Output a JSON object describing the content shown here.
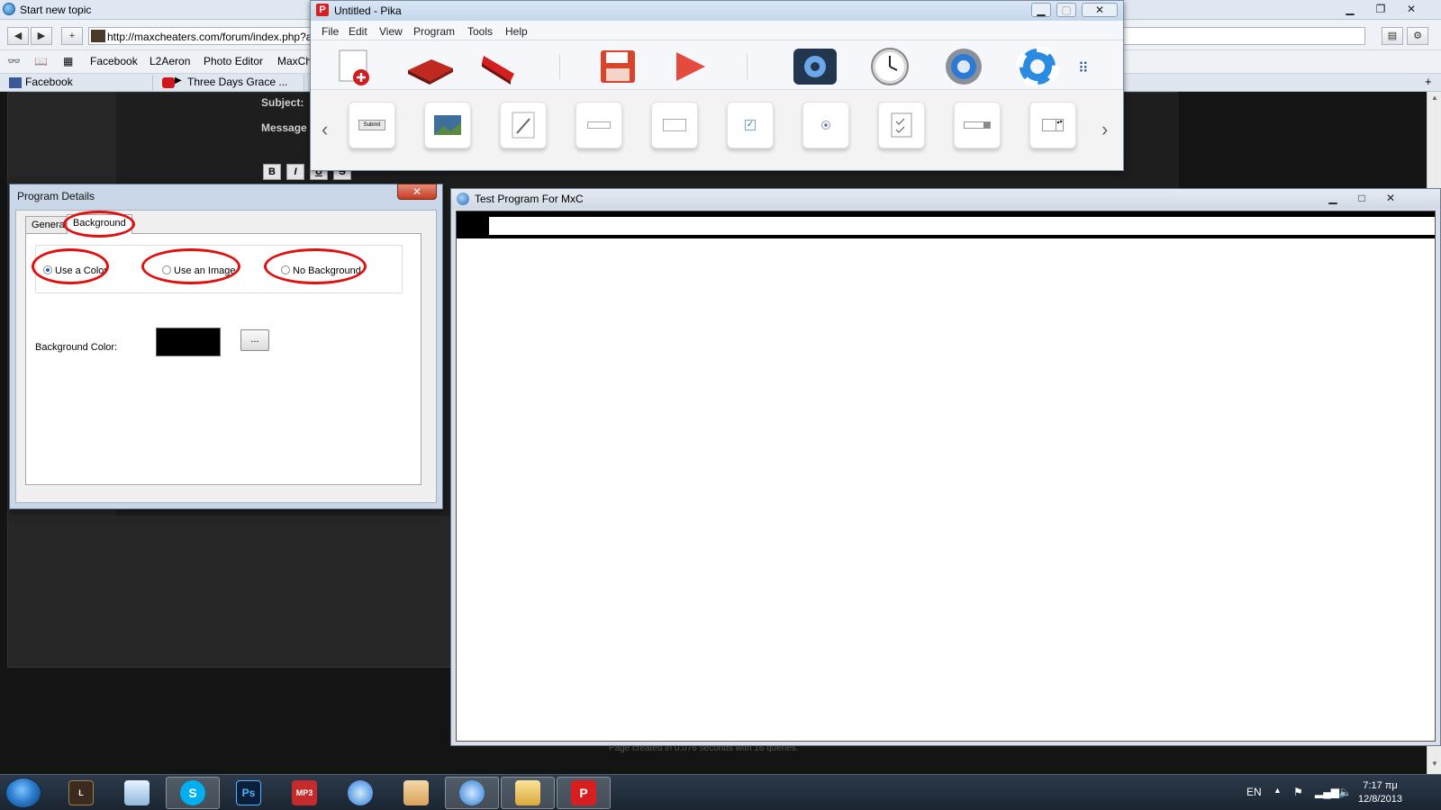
{
  "browser": {
    "tab_title": "Start new topic",
    "url": "http://maxcheaters.com/forum/index.php?a",
    "bookmarks": [
      "Facebook",
      "L2Aeron",
      "Photo Editor",
      "MaxChe"
    ],
    "tabs": [
      {
        "label": "Facebook"
      },
      {
        "label": "Three Days Grace ..."
      }
    ],
    "forum": {
      "subject_label": "Subject:",
      "message_label": "Message i",
      "format_buttons": [
        "B",
        "I",
        "U",
        "S"
      ],
      "footer": "Page created in 0.076 seconds with 16 queries."
    }
  },
  "pika": {
    "title": "Untitled - Pika",
    "menu": [
      "File",
      "Edit",
      "View",
      "Program",
      "Tools",
      "Help"
    ],
    "submit_preview": "Submit"
  },
  "details": {
    "title": "Program Details",
    "tabs": [
      "General",
      "Background"
    ],
    "radios": [
      {
        "label": "Use a Color",
        "checked": true
      },
      {
        "label": "Use an Image",
        "checked": false
      },
      {
        "label": "No Background",
        "checked": false
      }
    ],
    "bg_color_label": "Background Color:",
    "bg_color_value": "#000000",
    "browse_label": "...",
    "close_label": "✕"
  },
  "test_window": {
    "title": "Test Program For MxC"
  },
  "taskbar": {
    "language": "EN",
    "time": "7:17 πμ",
    "date": "12/8/2013"
  }
}
